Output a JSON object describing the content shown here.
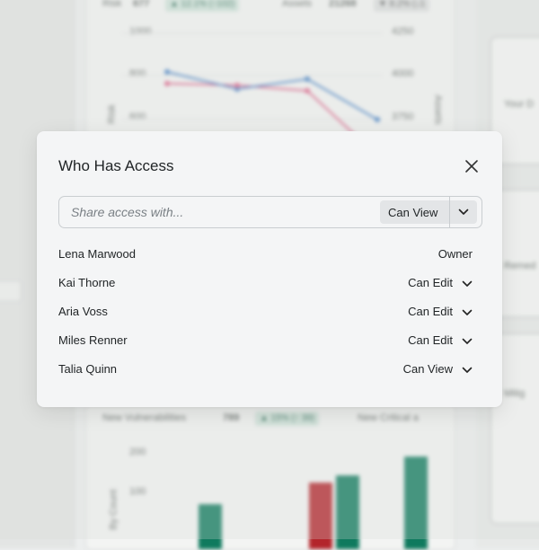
{
  "background": {
    "top_stats": [
      {
        "label": "Risk",
        "value": "677",
        "delta": "▲ 12.1% (↑102)"
      },
      {
        "label": "Assets",
        "value": "21268",
        "delta": "▼ 8.2% (↓1"
      }
    ],
    "top_chart": {
      "y_left_ticks": [
        "1000",
        "800",
        "600"
      ],
      "y_right_ticks": [
        "4250",
        "4000",
        "3750"
      ],
      "y_left_label": "Risk",
      "y_right_label": "Assets"
    },
    "bottom_stats": [
      {
        "label": "New Vulnerabilities",
        "value": "789",
        "delta": "▲ 15% (↑ 39)"
      },
      {
        "label": "New Critical a",
        "value": "",
        "delta": ""
      }
    ],
    "bottom_chart": {
      "y_ticks": [
        "200",
        "100"
      ],
      "y_label": "By Count"
    },
    "right_cards": [
      "Your D",
      "Remed",
      "Mitig"
    ],
    "colors": {
      "blue": "#3f7dc4",
      "pink": "#dd5d86",
      "green": "#0f7a5e",
      "red": "#b3252b"
    }
  },
  "dialog": {
    "title": "Who Has Access",
    "close_icon": "close-icon",
    "share_placeholder": "Share access with...",
    "share_permission": "Can View",
    "people": [
      {
        "name": "Lena Marwood",
        "role": "Owner",
        "dropdown": false
      },
      {
        "name": "Kai Thorne",
        "role": "Can Edit",
        "dropdown": true
      },
      {
        "name": "Aria Voss",
        "role": "Can Edit",
        "dropdown": true
      },
      {
        "name": "Miles Renner",
        "role": "Can Edit",
        "dropdown": true
      },
      {
        "name": "Talia Quinn",
        "role": "Can View",
        "dropdown": true
      }
    ]
  }
}
